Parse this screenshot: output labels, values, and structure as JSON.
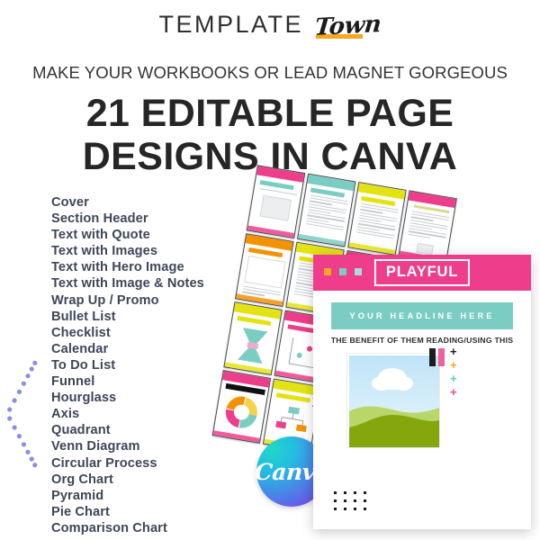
{
  "brand": {
    "primary": "TEMPLATE",
    "script": "Town",
    "highlight_color": "#F5A623"
  },
  "subtitle": "MAKE YOUR WORKBOOKS OR LEAD MAGNET GORGEOUS",
  "headline": {
    "line1": "21 EDITABLE PAGE",
    "line2": "DESIGNS IN CANVA",
    "count": 21
  },
  "design_list": [
    "Cover",
    "Section Header",
    "Text with Quote",
    "Text with Images",
    "Text with Hero Image",
    "Text with Image & Notes",
    "Wrap Up / Promo",
    "Bullet List",
    "Checklist",
    "Calendar",
    "To Do List",
    "Funnel",
    "Hourglass",
    "Axis",
    "Quadrant",
    "Venn Diagram",
    "Circular Process",
    "Org Chart",
    "Pyramid",
    "Pie Chart",
    "Comparison Chart"
  ],
  "canva_badge": {
    "label": "Canva"
  },
  "main_card": {
    "title": "PLAYFUL",
    "headline_band": "YOUR  HEADLINE  HERE",
    "benefit_line": "THE BENEFIT OF THEM READING/USING THIS",
    "header_color": "#EE3D8B",
    "band_color": "#7BCDC4",
    "window_dots": [
      "#F5A623",
      "#7BCDC4",
      "#A8DDD8"
    ],
    "swatches": [
      "#1c1c1c",
      "#F0609E"
    ],
    "plus_marks": [
      {
        "glyph": "+",
        "color": "#1c1c1c"
      },
      {
        "glyph": "+",
        "color": "#F5A623"
      },
      {
        "glyph": "+",
        "color": "#5BC8BE"
      },
      {
        "glyph": "+",
        "color": "#F0478F"
      }
    ]
  },
  "palette": {
    "pink": "#EE3D8B",
    "teal": "#7BCDC4",
    "yellow": "#E3E313",
    "orange": "#F39200",
    "dark_text": "#3d4758",
    "arc_dot": "#8b8ee0"
  },
  "mockups": {
    "rows": [
      [
        {
          "header": "#EE3D8B",
          "kind": "cover"
        },
        {
          "header": "#7BCDC4",
          "kind": "bullet-list"
        },
        {
          "header": "#E3E313",
          "kind": "checklist"
        },
        {
          "header": "#EE3D8B",
          "kind": "text-image"
        }
      ],
      [
        {
          "header": "#F39200",
          "kind": "calendar"
        },
        {
          "header": "#E3E313",
          "kind": "todo"
        },
        {
          "header": "#EE3D8B",
          "kind": "text-notes"
        },
        {
          "header": "#7BCDC4",
          "kind": "quote"
        }
      ],
      [
        {
          "header": "#E3E313",
          "kind": "hourglass"
        },
        {
          "header": "#EE3D8B",
          "kind": "axis"
        },
        {
          "header": "#7BCDC4",
          "kind": "quadrant"
        },
        {
          "header": "#F39200",
          "kind": "venn"
        }
      ],
      [
        {
          "header": "#EE3D8B",
          "kind": "circular-process"
        },
        {
          "header": "#E3E313",
          "kind": "org-chart"
        },
        {
          "header": "#7BCDC4",
          "kind": "pyramid"
        },
        {
          "header": "#EE3D8B",
          "kind": "pie"
        }
      ]
    ]
  }
}
